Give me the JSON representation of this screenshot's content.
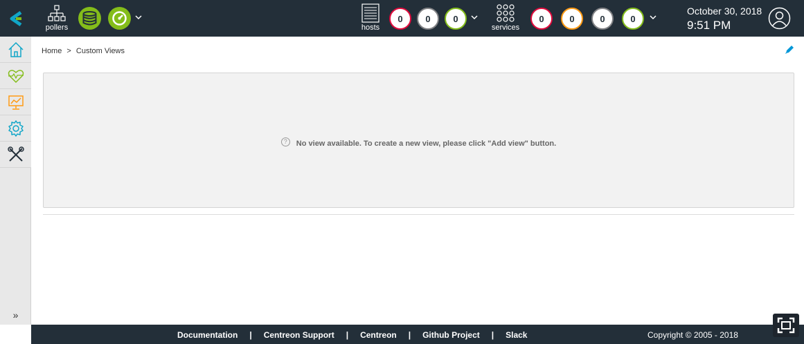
{
  "header": {
    "pollers_label": "pollers",
    "hosts": {
      "label": "hosts",
      "down": "0",
      "unreachable": "0",
      "up": "0"
    },
    "services": {
      "label": "services",
      "critical": "0",
      "warning": "0",
      "unknown": "0",
      "ok": "0"
    },
    "date": "October 30, 2018",
    "time": "9:51 PM"
  },
  "sidebar": {
    "items": [
      {
        "icon": "home-icon"
      },
      {
        "icon": "monitoring-heart-icon"
      },
      {
        "icon": "reporting-chart-icon"
      },
      {
        "icon": "configuration-gear-icon"
      },
      {
        "icon": "administration-tools-icon"
      }
    ],
    "expand_label": "»"
  },
  "breadcrumb": {
    "home": "Home",
    "separator": ">",
    "current": "Custom Views"
  },
  "main": {
    "empty_message": "No view available. To create a new view, please click \"Add view\" button.",
    "help_glyph": "?"
  },
  "footer": {
    "links": [
      "Documentation",
      "Centreon Support",
      "Centreon",
      "Github Project",
      "Slack"
    ],
    "separator": "|",
    "copyright": "Copyright © 2005 - 2018"
  },
  "colors": {
    "header_bg": "#232f39",
    "accent_green": "#84bd1a",
    "status_red": "#e00b3d",
    "status_orange": "#ff9a13",
    "status_grey": "#818285",
    "sidebar_bg": "#e8e8e8",
    "link_blue": "#0097d8"
  }
}
